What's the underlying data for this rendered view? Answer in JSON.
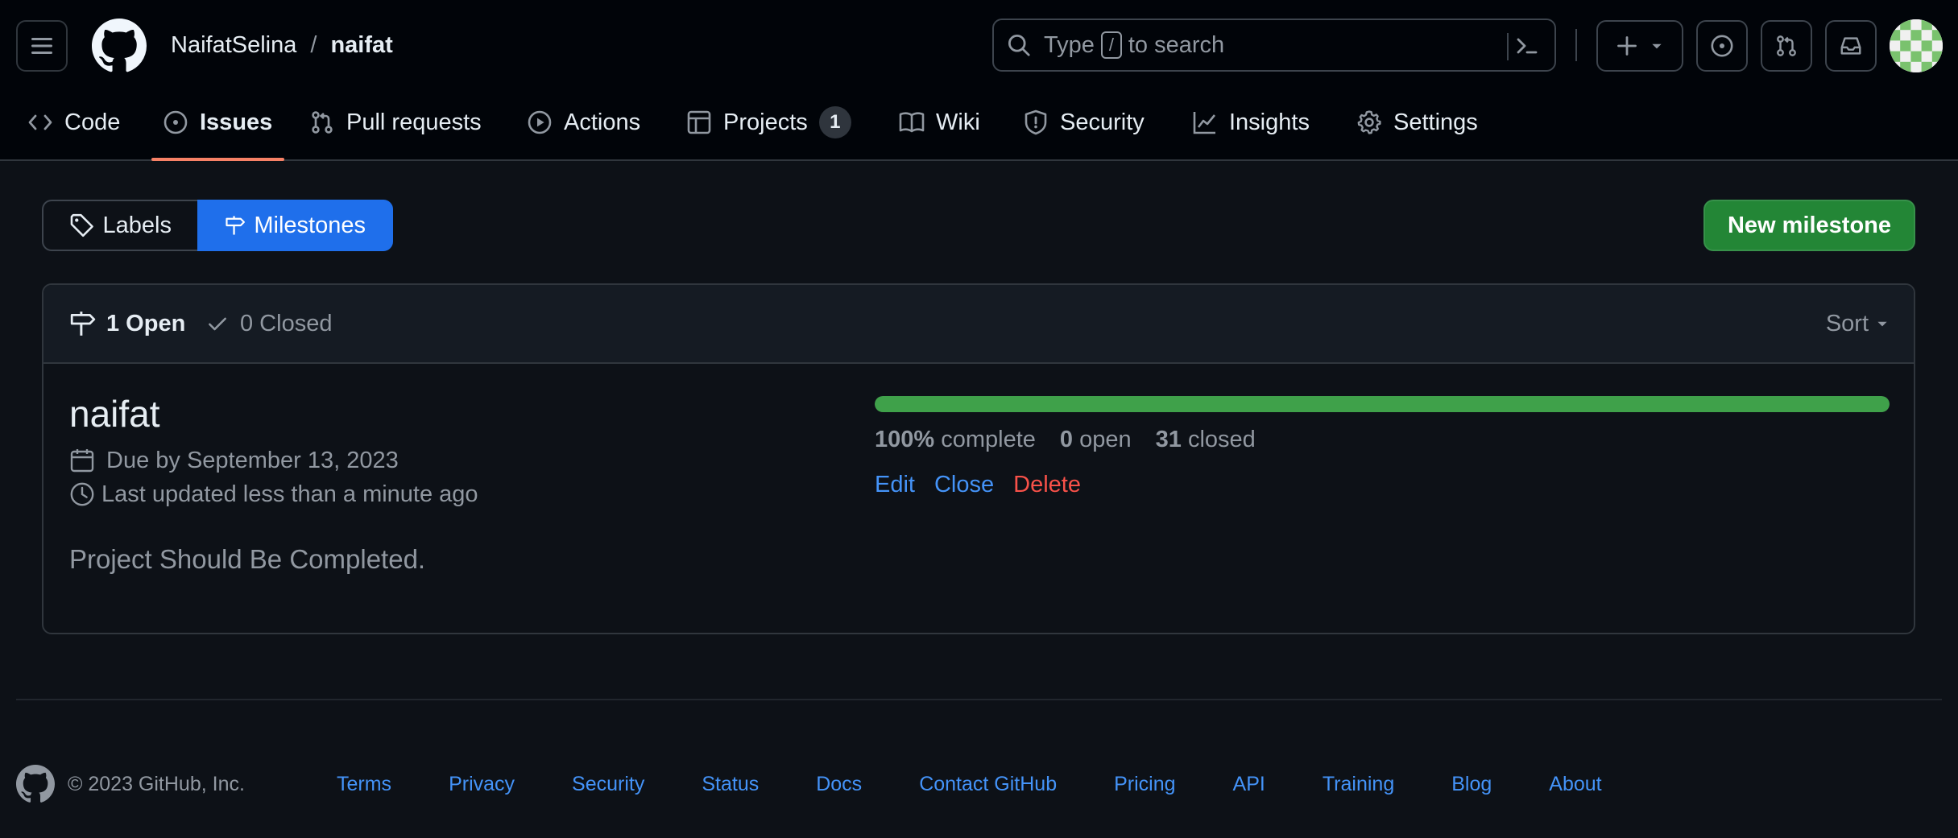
{
  "header": {
    "owner": "NaifatSelina",
    "separator": "/",
    "repo": "naifat",
    "search": {
      "prefix": "Type",
      "key": "/",
      "suffix": "to search"
    },
    "icons": [
      "hamburger-icon",
      "github-logo-icon",
      "search-icon",
      "command-palette-icon",
      "plus-icon",
      "chevron-down-icon",
      "issue-opened-icon",
      "pull-request-icon",
      "inbox-icon"
    ]
  },
  "repo_nav": {
    "items": [
      {
        "label": "Code",
        "icon": "code-icon"
      },
      {
        "label": "Issues",
        "icon": "issue-opened-icon",
        "active": true
      },
      {
        "label": "Pull requests",
        "icon": "pull-request-icon"
      },
      {
        "label": "Actions",
        "icon": "play-icon"
      },
      {
        "label": "Projects",
        "icon": "table-icon",
        "counter": "1"
      },
      {
        "label": "Wiki",
        "icon": "book-icon"
      },
      {
        "label": "Security",
        "icon": "shield-icon"
      },
      {
        "label": "Insights",
        "icon": "graph-icon"
      },
      {
        "label": "Settings",
        "icon": "gear-icon"
      }
    ]
  },
  "subnav": {
    "labels": "Labels",
    "milestones": "Milestones",
    "new_button": "New milestone"
  },
  "box_header": {
    "open_label": "1 Open",
    "closed_label": "0 Closed",
    "sort_label": "Sort"
  },
  "milestone": {
    "title": "naifat",
    "due": "Due by September 13, 2023",
    "updated": "Last updated less than a minute ago",
    "description": "Project Should Be Completed.",
    "progress_fraction": 1.0,
    "percent": "100%",
    "complete_label": "complete",
    "open_count": "0",
    "open_label": "open",
    "closed_count": "31",
    "closed_label": "closed",
    "actions": {
      "edit": "Edit",
      "close": "Close",
      "delete": "Delete"
    }
  },
  "footer": {
    "copyright": "© 2023 GitHub, Inc.",
    "links": [
      "Terms",
      "Privacy",
      "Security",
      "Status",
      "Docs",
      "Contact GitHub",
      "Pricing",
      "API",
      "Training",
      "Blog",
      "About"
    ]
  },
  "colors": {
    "accent": "#1f6feb",
    "primary_button": "#238636",
    "progress": "#3fa14a",
    "link": "#4493f8",
    "danger": "#f85149",
    "nav_underline": "#f78166"
  }
}
